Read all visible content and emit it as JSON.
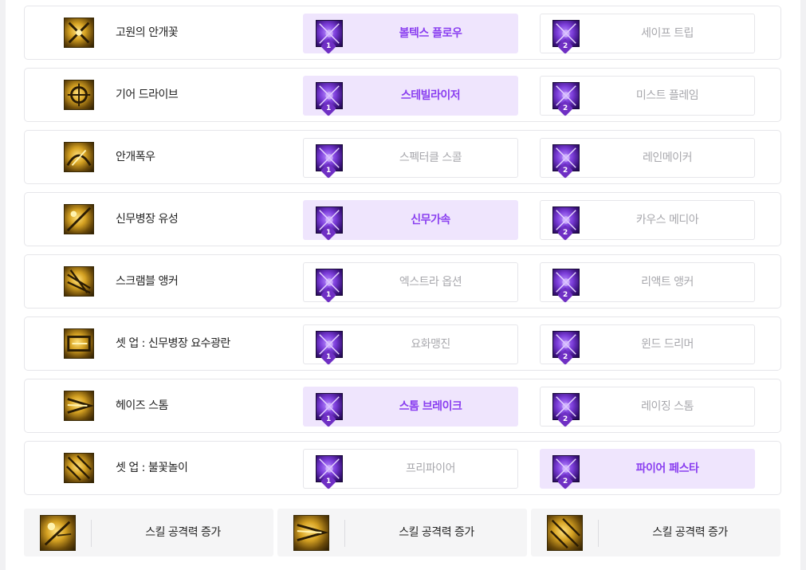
{
  "rows": [
    {
      "name": "고원의 안개꽃",
      "icon": "mist-flower-skill-icon",
      "options": [
        {
          "label": "볼텍스 플로우",
          "num": "1",
          "selected": true
        },
        {
          "label": "세이프 트립",
          "num": "2",
          "selected": false
        }
      ]
    },
    {
      "name": "기어 드라이브",
      "icon": "gear-drive-skill-icon",
      "options": [
        {
          "label": "스테빌라이저",
          "num": "1",
          "selected": true
        },
        {
          "label": "미스트 플레임",
          "num": "2",
          "selected": false
        }
      ]
    },
    {
      "name": "안개폭우",
      "icon": "mist-rain-skill-icon",
      "options": [
        {
          "label": "스펙터클 스콜",
          "num": "1",
          "selected": false
        },
        {
          "label": "레인메이커",
          "num": "2",
          "selected": false
        }
      ]
    },
    {
      "name": "신무병장 유성",
      "icon": "meteor-weapon-skill-icon",
      "options": [
        {
          "label": "신무가속",
          "num": "1",
          "selected": true
        },
        {
          "label": "카우스 메디아",
          "num": "2",
          "selected": false
        }
      ]
    },
    {
      "name": "스크램블 앵커",
      "icon": "scramble-anchor-skill-icon",
      "options": [
        {
          "label": "엑스트라 옵션",
          "num": "1",
          "selected": false
        },
        {
          "label": "리액트 앵커",
          "num": "2",
          "selected": false
        }
      ]
    },
    {
      "name": "셋 업 : 신무병장 요수광란",
      "icon": "setup-weapon-skill-icon",
      "options": [
        {
          "label": "요화맹진",
          "num": "1",
          "selected": false
        },
        {
          "label": "윈드 드리머",
          "num": "2",
          "selected": false
        }
      ]
    },
    {
      "name": "헤이즈 스톰",
      "icon": "haze-storm-skill-icon",
      "options": [
        {
          "label": "스톰 브레이크",
          "num": "1",
          "selected": true
        },
        {
          "label": "레이징 스톰",
          "num": "2",
          "selected": false
        }
      ]
    },
    {
      "name": "셋 업 : 불꽃놀이",
      "icon": "setup-firework-skill-icon",
      "options": [
        {
          "label": "프리파이어",
          "num": "1",
          "selected": false
        },
        {
          "label": "파이어 페스타",
          "num": "2",
          "selected": true
        }
      ]
    }
  ],
  "stats": [
    {
      "label": "스킬 공격력 증가",
      "icon": "meteor-weapon-skill-icon"
    },
    {
      "label": "스킬 공격력 증가",
      "icon": "haze-storm-skill-icon"
    },
    {
      "label": "스킬 공격력 증가",
      "icon": "setup-firework-skill-icon"
    }
  ],
  "colors": {
    "selected_bg": "#efe5fd",
    "selected_text": "#8a3ff0",
    "inactive_text": "#a8a8ad",
    "badge": "#6f2fc4"
  }
}
